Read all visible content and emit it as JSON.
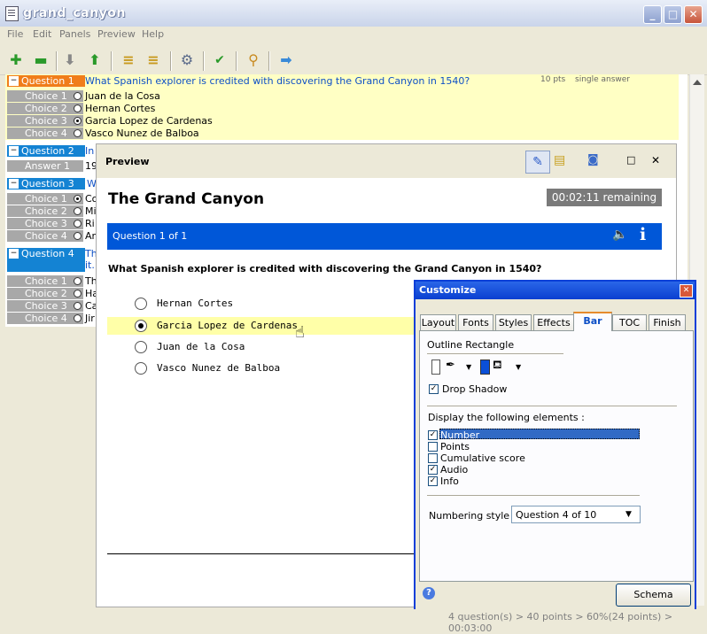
{
  "window": {
    "title": "grand_canyon"
  },
  "menu": [
    "File",
    "Edit",
    "Panels",
    "Preview",
    "Help"
  ],
  "questions": [
    {
      "label": "Question 1",
      "text": "What Spanish explorer is credited with discovering the Grand Canyon in 1540?",
      "points": "10 pts",
      "type": "single answer",
      "choices": [
        {
          "label": "Choice 1",
          "text": "Juan de la Cosa",
          "selected": false
        },
        {
          "label": "Choice 2",
          "text": "Hernan Cortes",
          "selected": false
        },
        {
          "label": "Choice 3",
          "text": "Garcia Lopez de Cardenas",
          "selected": true
        },
        {
          "label": "Choice 4",
          "text": "Vasco Nunez de Balboa",
          "selected": false
        }
      ]
    },
    {
      "label": "Question 2",
      "text": "In",
      "answer_label": "Answer 1",
      "answer_text": "19"
    },
    {
      "label": "Question 3",
      "text": "W",
      "choices": [
        {
          "label": "Choice 1",
          "text": "Co",
          "selected": true
        },
        {
          "label": "Choice 2",
          "text": "Mi",
          "selected": false
        },
        {
          "label": "Choice 3",
          "text": "Ri",
          "selected": false
        },
        {
          "label": "Choice 4",
          "text": "Ar",
          "selected": false
        }
      ]
    },
    {
      "label": "Question 4",
      "text_line1": "Th",
      "text_line2": "it.",
      "choices": [
        {
          "label": "Choice 1",
          "text": "Th",
          "selected": false
        },
        {
          "label": "Choice 2",
          "text": "Ha",
          "selected": false
        },
        {
          "label": "Choice 3",
          "text": "Ca",
          "selected": false
        },
        {
          "label": "Choice 4",
          "text": "Jir",
          "selected": false
        }
      ]
    }
  ],
  "preview": {
    "panel_title": "Preview",
    "quiz_title": "The Grand Canyon",
    "timer": "00:02:11 remaining",
    "bar_text": "Question 1 of 1",
    "question": "What Spanish explorer is credited with discovering the Grand Canyon in 1540?",
    "options": [
      {
        "text": "Hernan Cortes",
        "selected": false
      },
      {
        "text": "Garcia Lopez de Cardenas",
        "selected": true
      },
      {
        "text": "Juan de la Cosa",
        "selected": false
      },
      {
        "text": "Vasco Nunez de Balboa",
        "selected": false
      }
    ]
  },
  "customize": {
    "title": "Customize",
    "tabs": [
      "Layout",
      "Fonts",
      "Styles",
      "Effects",
      "Bar",
      "TOC",
      "Finish"
    ],
    "active_tab": "Bar",
    "outline_label": "Outline Rectangle",
    "drop_shadow_label": "Drop Shadow",
    "drop_shadow_checked": true,
    "display_label": "Display the following elements :",
    "elements": [
      {
        "label": "Number",
        "checked": true,
        "highlighted": true
      },
      {
        "label": "Points",
        "checked": false
      },
      {
        "label": "Cumulative score",
        "checked": false
      },
      {
        "label": "Audio",
        "checked": true
      },
      {
        "label": "Info",
        "checked": true
      }
    ],
    "numbering_label": "Numbering style",
    "numbering_value": "Question 4 of 10",
    "schema_button": "Schema",
    "fill_color": "#0a4fd8"
  },
  "status": "4 question(s) > 40 points > 60%(24 points) > 00:03:00",
  "colors": {
    "q1_header": "#f07d1a",
    "q_header": "#1483d3",
    "q1_bg": "#ffffc4",
    "accent_blue": "#0057d8"
  }
}
